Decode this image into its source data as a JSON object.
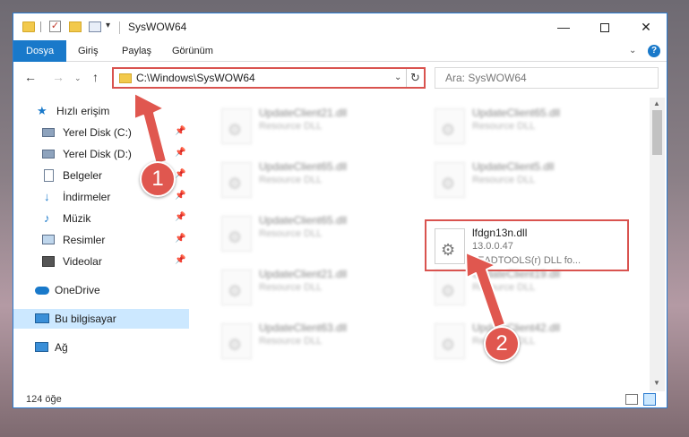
{
  "window": {
    "title": "SysWOW64",
    "min_glyph": "—",
    "close_glyph": "✕"
  },
  "quick_access_toolbar": {
    "check_glyph": "✓",
    "dropdown_glyph": "▾"
  },
  "ribbon": {
    "tabs": [
      "Dosya",
      "Giriş",
      "Paylaş",
      "Görünüm"
    ],
    "expand_glyph": "⌄",
    "help_glyph": "?"
  },
  "nav": {
    "back_glyph": "←",
    "forward_glyph": "→",
    "recent_glyph": "⌄",
    "up_glyph": "↑"
  },
  "address": {
    "path": "C:\\Windows\\SysWOW64",
    "dropdown_glyph": "⌄",
    "refresh_glyph": "↻"
  },
  "search": {
    "placeholder": "Ara: SysWOW64"
  },
  "sidebar": {
    "pin_glyph": "📌",
    "items": [
      {
        "label": "Hızlı erişim",
        "icon": "star-icon"
      },
      {
        "label": "Yerel Disk (C:)",
        "icon": "drive-icon",
        "pinned": true
      },
      {
        "label": "Yerel Disk (D:)",
        "icon": "drive-icon",
        "pinned": true
      },
      {
        "label": "Belgeler",
        "icon": "documents-icon",
        "pinned": true
      },
      {
        "label": "İndirmeler",
        "icon": "download-icon",
        "pinned": true
      },
      {
        "label": "Müzik",
        "icon": "music-icon",
        "pinned": true
      },
      {
        "label": "Resimler",
        "icon": "pictures-icon",
        "pinned": true
      },
      {
        "label": "Videolar",
        "icon": "videos-icon",
        "pinned": true
      },
      {
        "label": "OneDrive",
        "icon": "cloud-icon"
      },
      {
        "label": "Bu bilgisayar",
        "icon": "computer-icon",
        "selected": true
      },
      {
        "label": "Ağ",
        "icon": "network-icon"
      }
    ]
  },
  "files": {
    "left_column": [
      {
        "name": "UpdateClient21.dll",
        "desc": "Resource DLL"
      },
      {
        "name": "UpdateClient65.dll",
        "desc": "Resource DLL"
      },
      {
        "name": "UpdateClient65.dll",
        "desc": "Resource DLL"
      },
      {
        "name": "UpdateClient21.dll",
        "desc": "Resource DLL"
      },
      {
        "name": "UpdateClient63.dll",
        "desc": "Resource DLL"
      }
    ],
    "right_column": [
      {
        "name": "UpdateClient65.dll",
        "desc": "Resource DLL"
      },
      {
        "name": "UpdateClient5.dll",
        "desc": "Resource DLL"
      },
      {
        "name": "lfdgn13n.dll",
        "version": "13.0.0.47",
        "company": "LEADTOOLS(r) DLL fo...",
        "highlighted": true
      },
      {
        "name": "UpdateClient19.dll",
        "desc": "Resource DLL"
      },
      {
        "name": "UpdateClient42.dll",
        "desc": "Resource DLL"
      }
    ],
    "gear_glyph": "⚙"
  },
  "scrollbar": {
    "up_glyph": "▲",
    "down_glyph": "▼"
  },
  "status": {
    "item_count": "124 öğe"
  },
  "annotations": {
    "step1": "1",
    "step2": "2",
    "color": "#e0574f"
  }
}
